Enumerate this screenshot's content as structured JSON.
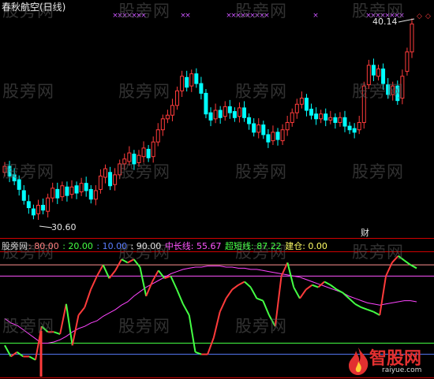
{
  "indicator_title": "春秋航空(日线)",
  "price_high_label": "40.14",
  "price_low_label": "30.60",
  "cai_marker": "财",
  "legend": {
    "name": "股旁网",
    "v80": ": 80.00",
    "v20": ": 20.00",
    "v10": ": 10.00",
    "v90": ": 90.00",
    "mid_line": "中长线: 55.67",
    "super_short": "超短线: 87.22",
    "position": "建仓: 0.00"
  },
  "watermark_text": "股旁网",
  "logo": {
    "name": "智股网",
    "url": "raiyue.com"
  },
  "colors": {
    "up": "#ff3b3b",
    "down": "#00ffff",
    "dashed_up": "#ff3b3b",
    "line_80": "#ff9090",
    "line_90": "#ff55ff",
    "line_20": "#44ff44",
    "line_10": "#5a7dff",
    "mid_line": "#ff44ff",
    "super_short_up": "#ff3b3b",
    "super_short_down": "#44ff44",
    "grid": "#d00000"
  },
  "chart_data": [
    {
      "type": "candlestick",
      "title": "春秋航空(日线)",
      "annotations": [
        "40.14",
        "30.60"
      ],
      "series": [
        {
          "o": 34.5,
          "c": 35.0
        },
        {
          "o": 35.0,
          "c": 34.2
        },
        {
          "o": 34.3,
          "c": 33.8
        },
        {
          "o": 33.9,
          "c": 33.1
        },
        {
          "o": 33.0,
          "c": 32.2
        },
        {
          "o": 32.1,
          "c": 31.6
        },
        {
          "o": 31.5,
          "c": 31.0
        },
        {
          "o": 31.1,
          "c": 31.8
        },
        {
          "o": 31.8,
          "c": 31.4
        },
        {
          "o": 31.3,
          "c": 32.4
        },
        {
          "o": 32.4,
          "c": 33.2
        },
        {
          "o": 33.1,
          "c": 32.4
        },
        {
          "o": 32.5,
          "c": 33.4
        },
        {
          "o": 33.3,
          "c": 32.6
        },
        {
          "o": 32.7,
          "c": 33.3
        },
        {
          "o": 33.4,
          "c": 32.8
        },
        {
          "o": 32.9,
          "c": 33.6
        },
        {
          "o": 33.6,
          "c": 33.0
        },
        {
          "o": 33.1,
          "c": 32.3
        },
        {
          "o": 32.3,
          "c": 33.0
        },
        {
          "o": 33.1,
          "c": 34.2
        },
        {
          "o": 34.1,
          "c": 34.8
        },
        {
          "o": 34.5,
          "c": 33.4
        },
        {
          "o": 33.5,
          "c": 34.3
        },
        {
          "o": 34.3,
          "c": 35.2
        },
        {
          "o": 35.2,
          "c": 35.6
        },
        {
          "o": 35.4,
          "c": 36.1
        },
        {
          "o": 36.0,
          "c": 35.2
        },
        {
          "o": 35.3,
          "c": 35.9
        },
        {
          "o": 35.8,
          "c": 36.5
        },
        {
          "o": 36.4,
          "c": 35.7
        },
        {
          "o": 35.8,
          "c": 37.0
        },
        {
          "o": 37.0,
          "c": 38.0
        },
        {
          "o": 38.0,
          "c": 38.9
        },
        {
          "o": 38.9,
          "c": 39.2
        },
        {
          "o": 39.2,
          "c": 40.0
        },
        {
          "o": 40.0,
          "c": 41.2
        },
        {
          "o": 41.2,
          "c": 42.4
        },
        {
          "o": 42.3,
          "c": 41.5
        },
        {
          "o": 41.6,
          "c": 42.6
        },
        {
          "o": 42.6,
          "c": 41.8
        },
        {
          "o": 41.8,
          "c": 41.0
        },
        {
          "o": 41.0,
          "c": 39.3
        },
        {
          "o": 39.4,
          "c": 38.8
        },
        {
          "o": 38.9,
          "c": 39.6
        },
        {
          "o": 39.6,
          "c": 39.0
        },
        {
          "o": 39.1,
          "c": 39.9
        },
        {
          "o": 39.9,
          "c": 39.4
        },
        {
          "o": 39.5,
          "c": 39.0
        },
        {
          "o": 39.1,
          "c": 39.8
        },
        {
          "o": 39.8,
          "c": 39.0
        },
        {
          "o": 39.0,
          "c": 38.5
        },
        {
          "o": 38.5,
          "c": 37.8
        },
        {
          "o": 37.8,
          "c": 38.4
        },
        {
          "o": 38.4,
          "c": 37.6
        },
        {
          "o": 37.6,
          "c": 37.0
        },
        {
          "o": 37.1,
          "c": 37.8
        },
        {
          "o": 37.8,
          "c": 37.2
        },
        {
          "o": 37.1,
          "c": 38.0
        },
        {
          "o": 38.0,
          "c": 38.6
        },
        {
          "o": 38.6,
          "c": 39.4
        },
        {
          "o": 39.4,
          "c": 40.1
        },
        {
          "o": 40.1,
          "c": 40.6
        },
        {
          "o": 40.6,
          "c": 39.6
        },
        {
          "o": 39.7,
          "c": 39.2
        },
        {
          "o": 39.3,
          "c": 38.9
        },
        {
          "o": 38.9,
          "c": 39.3
        },
        {
          "o": 39.3,
          "c": 38.8
        },
        {
          "o": 38.8,
          "c": 39.0
        },
        {
          "o": 39.0,
          "c": 38.6
        },
        {
          "o": 38.6,
          "c": 39.0
        },
        {
          "o": 39.0,
          "c": 38.3
        },
        {
          "o": 38.3,
          "c": 38.0
        },
        {
          "o": 38.1,
          "c": 37.8
        },
        {
          "o": 38.0,
          "c": 38.6
        },
        {
          "o": 38.6,
          "c": 41.6
        },
        {
          "o": 41.7,
          "c": 43.3
        },
        {
          "o": 43.3,
          "c": 42.5
        },
        {
          "o": 42.4,
          "c": 43.0
        },
        {
          "o": 43.0,
          "c": 41.8
        },
        {
          "o": 41.7,
          "c": 40.9
        },
        {
          "o": 40.9,
          "c": 41.6
        },
        {
          "o": 41.6,
          "c": 40.4
        },
        {
          "o": 40.6,
          "c": 42.4
        },
        {
          "o": 42.8,
          "c": 44.4
        },
        {
          "o": 44.4,
          "c": 46.7
        }
      ],
      "ylim": [
        29.5,
        47.5
      ]
    },
    {
      "type": "line",
      "legend": [
        "中长线",
        "超短线"
      ],
      "levels": {
        "v90": 90,
        "v80": 80,
        "v20": 20,
        "v10": 10
      },
      "series": [
        {
          "name": "中长线",
          "values": [
            42,
            38,
            36,
            32,
            28,
            24,
            20,
            20,
            21,
            23,
            26,
            30,
            33,
            35,
            38,
            40,
            44,
            47,
            50,
            54,
            57,
            62,
            66,
            70,
            73,
            76,
            79,
            82,
            84,
            86,
            87,
            88,
            88,
            89,
            89,
            89,
            88,
            88,
            87,
            87,
            86,
            86,
            85,
            84,
            83,
            82,
            81,
            80,
            79,
            77,
            75,
            73,
            71,
            69,
            67,
            65,
            62,
            60,
            58,
            56,
            55,
            54,
            55,
            56,
            57,
            58,
            58,
            57
          ]
        },
        {
          "name": "超短线",
          "values": [
            18,
            8,
            12,
            8,
            8,
            5,
            35,
            30,
            30,
            28,
            55,
            18,
            45,
            52,
            68,
            80,
            90,
            78,
            85,
            95,
            92,
            95,
            88,
            62,
            75,
            85,
            78,
            80,
            68,
            55,
            45,
            12,
            10,
            10,
            25,
            48,
            60,
            68,
            72,
            75,
            70,
            60,
            58,
            45,
            35,
            80,
            92,
            70,
            60,
            68,
            72,
            70,
            75,
            72,
            68,
            65,
            60,
            55,
            52,
            50,
            48,
            45,
            80,
            92,
            98,
            94,
            90,
            87
          ]
        }
      ]
    }
  ]
}
